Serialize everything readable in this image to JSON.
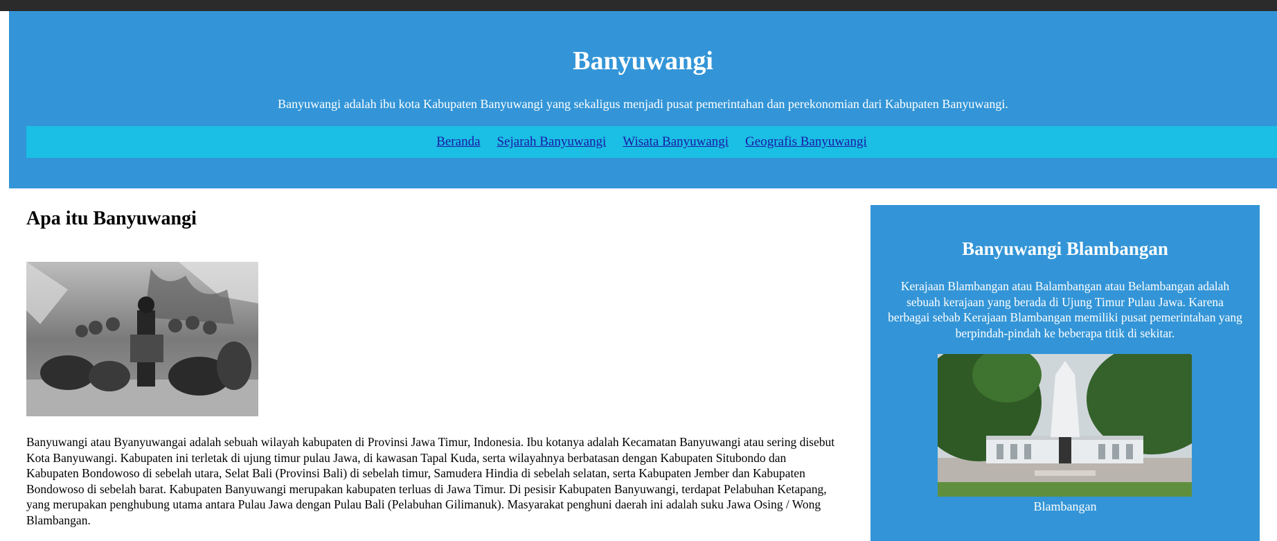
{
  "header": {
    "title": "Banyuwangi",
    "description": "Banyuwangi adalah ibu kota Kabupaten Banyuwangi yang sekaligus menjadi pusat pemerintahan dan perekonomian dari Kabupaten Banyuwangi."
  },
  "nav": {
    "items": [
      {
        "label": "Beranda"
      },
      {
        "label": "Sejarah Banyuwangi"
      },
      {
        "label": "Wisata Banyuwangi"
      },
      {
        "label": "Geografis Banyuwangi"
      }
    ]
  },
  "main": {
    "heading": "Apa itu Banyuwangi",
    "paragraph": "Banyuwangi atau Byanyuwangai adalah sebuah wilayah kabupaten di Provinsi Jawa Timur, Indonesia. Ibu kotanya adalah Kecamatan Banyuwangi atau sering disebut Kota Banyuwangi. Kabupaten ini terletak di ujung timur pulau Jawa, di kawasan Tapal Kuda, serta wilayahnya berbatasan dengan Kabupaten Situbondo dan Kabupaten Bondowoso di sebelah utara, Selat Bali (Provinsi Bali) di sebelah timur, Samudera Hindia di sebelah selatan, serta Kabupaten Jember dan Kabupaten Bondowoso di sebelah barat. Kabupaten Banyuwangi merupakan kabupaten terluas di Jawa Timur. Di pesisir Kabupaten Banyuwangi, terdapat Pelabuhan Ketapang, yang merupakan penghubung utama antara Pulau Jawa dengan Pulau Bali (Pelabuhan Gilimanuk). Masyarakat penghuni daerah ini adalah suku Jawa Osing / Wong Blambangan."
  },
  "aside": {
    "title": "Banyuwangi Blambangan",
    "text": "Kerajaan Blambangan atau Balambangan atau Belambangan adalah sebuah kerajaan yang berada di Ujung Timur Pulau Jawa. Karena berbagai sebab Kerajaan Blambangan memiliki pusat pemerintahan yang berpindah-pindah ke beberapa titik di sekitar.",
    "caption": "Blambangan"
  },
  "colors": {
    "header_bg": "#3395d7",
    "nav_bg": "#1bbee4",
    "link": "#1a1aa6",
    "top_bar": "#2b2b2b"
  }
}
